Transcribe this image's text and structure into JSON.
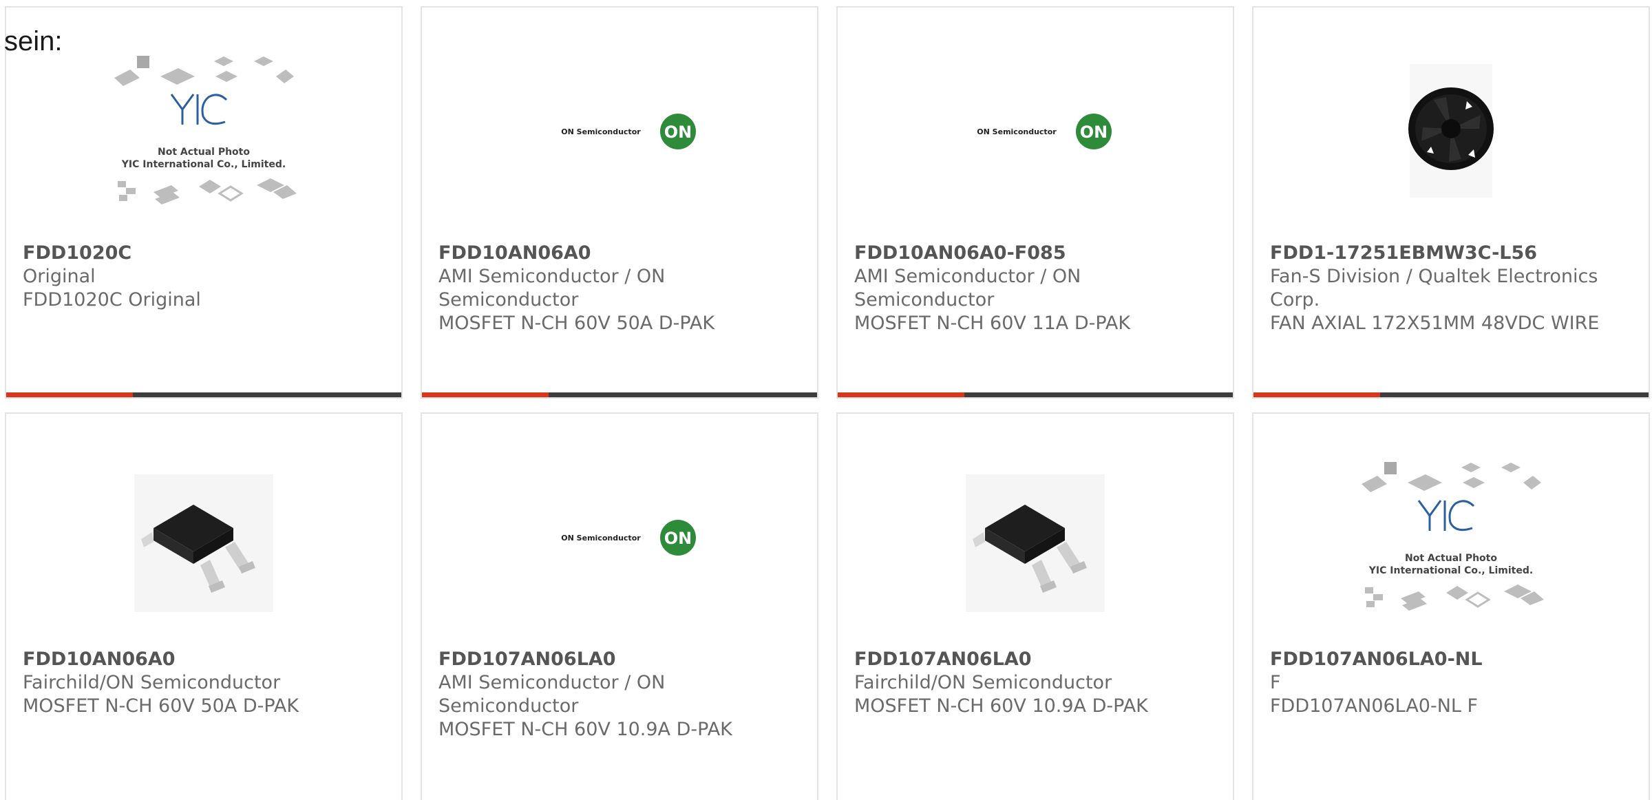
{
  "intro": "sein:",
  "colors": {
    "accent": "#d9361b",
    "bar_track": "#3d3d3d",
    "border": "#e3e3e3",
    "text_bold": "#555555",
    "text": "#6a6a6a",
    "on_green": "#2e8b3a"
  },
  "cards": [
    {
      "part_number": "FDD1020C",
      "manufacturer": "Original",
      "description": "FDD1020C Original",
      "image": "placeholder",
      "img_line1": "Not Actual Photo",
      "img_line2": "YIC International Co., Limited.",
      "progress": 0.32
    },
    {
      "part_number": "FDD10AN06A0",
      "manufacturer": "AMI Semiconductor / ON Semiconductor",
      "description": "MOSFET N-CH 60V 50A D-PAK",
      "image": "on-semi-logo",
      "img_brand": "ON Semiconductor",
      "img_badge": "ON",
      "progress": 0.32
    },
    {
      "part_number": "FDD10AN06A0-F085",
      "manufacturer": "AMI Semiconductor / ON Semiconductor",
      "description": "MOSFET N-CH 60V 11A D-PAK",
      "image": "on-semi-logo",
      "img_brand": "ON Semiconductor",
      "img_badge": "ON",
      "progress": 0.32
    },
    {
      "part_number": "FDD1-17251EBMW3C-L56",
      "manufacturer": "Fan-S Division / Qualtek Electronics Corp.",
      "description": "FAN AXIAL 172X51MM 48VDC WIRE",
      "image": "fan",
      "progress": 0.32
    },
    {
      "part_number": "FDD10AN06A0",
      "manufacturer": "Fairchild/ON Semiconductor",
      "description": "MOSFET N-CH 60V 50A D-PAK",
      "image": "dpak"
    },
    {
      "part_number": "FDD107AN06LA0",
      "manufacturer": "AMI Semiconductor / ON Semiconductor",
      "description": "MOSFET N-CH 60V 10.9A D-PAK",
      "image": "on-semi-logo",
      "img_brand": "ON Semiconductor",
      "img_badge": "ON"
    },
    {
      "part_number": "FDD107AN06LA0",
      "manufacturer": "Fairchild/ON Semiconductor",
      "description": "MOSFET N-CH 60V 10.9A D-PAK",
      "image": "dpak"
    },
    {
      "part_number": "FDD107AN06LA0-NL",
      "manufacturer": "F",
      "description": "FDD107AN06LA0-NL F",
      "image": "placeholder",
      "img_line1": "Not Actual Photo",
      "img_line2": "YIC International Co., Limited."
    }
  ]
}
